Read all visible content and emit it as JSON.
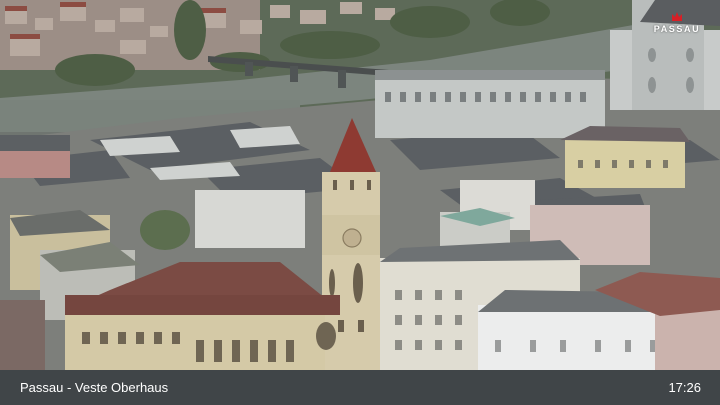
{
  "webcam": {
    "brand_logo": "PASSAU",
    "location_title": "Passau - Veste Oberhaus",
    "time": "17:26",
    "logo_icon": "crown-icon",
    "colors": {
      "caption_bar": "#30343a",
      "caption_text": "#ffffff",
      "logo_mark": "#d81f26",
      "river": "#7c857e",
      "roofs": "#7b4b44",
      "tower_roof": "#8e3a32"
    }
  }
}
